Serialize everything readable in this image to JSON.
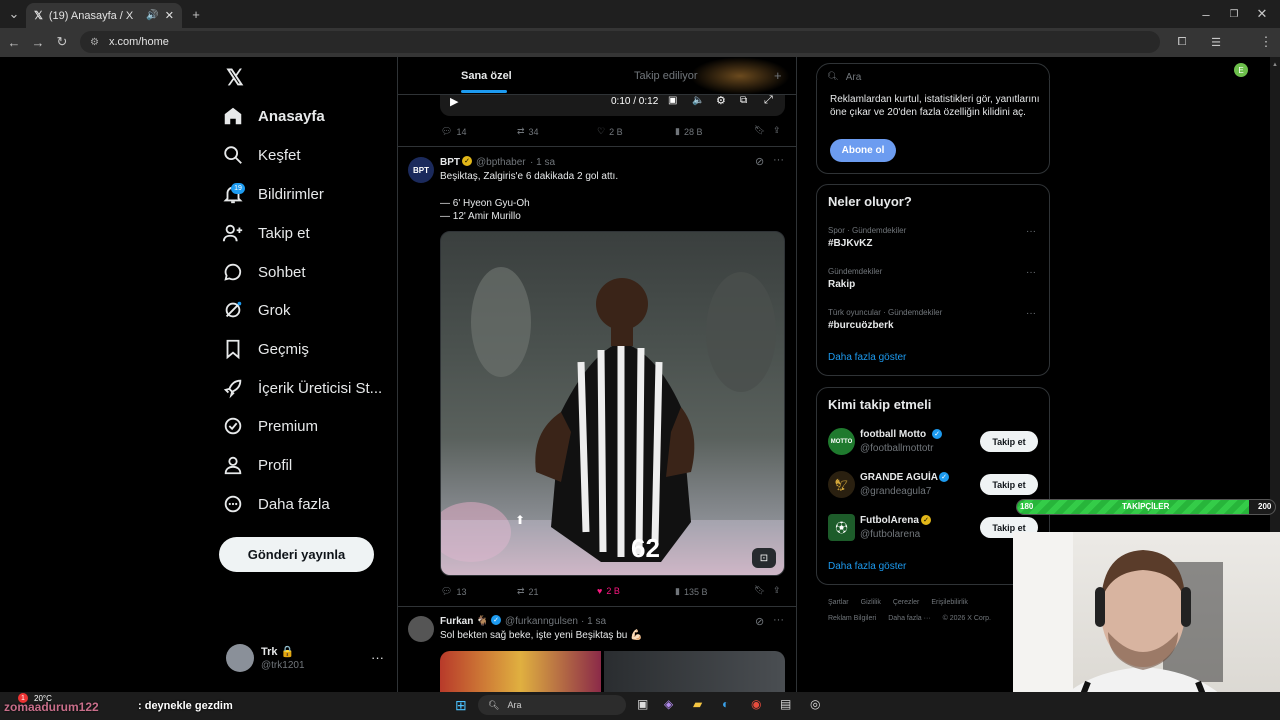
{
  "browser": {
    "tab_title": "(19) Anasayfa / X",
    "url": "x.com/home"
  },
  "nav": {
    "items": [
      "Anasayfa",
      "Keşfet",
      "Bildirimler",
      "Takip et",
      "Sohbet",
      "Grok",
      "Geçmiş",
      "İçerik Üreticisi St...",
      "Premium",
      "Profil",
      "Daha fazla"
    ],
    "notif_badge": "19",
    "post_button": "Gönderi yayınla",
    "account": {
      "name": "Trk 🔒",
      "handle": "@trk1201"
    }
  },
  "tabs": {
    "for_you": "Sana özel",
    "following": "Takip ediliyor"
  },
  "video": {
    "time": "0:10 / 0:12"
  },
  "prev_post_actions": {
    "replies": "14",
    "reposts": "34",
    "likes": "2 B",
    "views": "28 B"
  },
  "post1": {
    "author": "BPT",
    "handle": "@bpthaber",
    "time": "· 1 sa",
    "text1": "Beşiktaş, Zalgiris'e 6 dakikada 2 gol attı.",
    "line2": "— 6' Hyeon Gyu-Oh",
    "line3": "— 12' Amir Murillo",
    "replies": "13",
    "reposts": "21",
    "likes": "2 B",
    "views": "135 B"
  },
  "post2": {
    "author": "Furkan 🐐",
    "handle": "@furkanngulsen",
    "time": "· 1 sa",
    "text": "Sol bekten sağ beke, işte yeni Beşiktaş bu 💪🏻"
  },
  "search": {
    "placeholder": "Ara"
  },
  "premium": {
    "text": "Reklamlardan kurtul, istatistikleri gör, yanıtlarını öne çıkar ve 20'den fazla özelliğin kilidini aç.",
    "button": "Abone ol"
  },
  "trends": {
    "title": "Neler oluyor?",
    "items": [
      {
        "context": "Spor · Gündemdekiler",
        "name": "#BJKvKZ"
      },
      {
        "context": "Gündemdekiler",
        "name": "Rakip"
      },
      {
        "context": "Türk oyuncular · Gündemdekiler",
        "name": "#burcuözberk"
      }
    ],
    "more": "Daha fazla göster"
  },
  "who_to_follow": {
    "title": "Kimi takip etmeli",
    "items": [
      {
        "name": "football Motto",
        "handle": "@footballmottotr",
        "button": "Takip et"
      },
      {
        "name": "GRANDE AGUİA",
        "handle": "@grandeagula7",
        "button": "Takip et"
      },
      {
        "name": "FutbolArena",
        "handle": "@futbolarena",
        "button": "Takip et"
      }
    ],
    "more": "Daha fazla göster"
  },
  "footer": {
    "links1": [
      "Şartlar",
      "Gizlilik",
      "Çerezler",
      "Erişilebilirlik"
    ],
    "links2": [
      "Reklam Bilgileri",
      "Daha fazla ···",
      "© 2026 X Corp."
    ]
  },
  "overlay": {
    "left": "180",
    "label": "TAKİPÇİLER",
    "right": "200",
    "progress": 0.9
  },
  "chat": {
    "user": "zomaadurum122",
    "message": ": deynekle gezdim"
  },
  "taskbar": {
    "weather": "20°C",
    "search": "Ara"
  },
  "colors": {
    "accent": "#1d9bf0",
    "like": "#f91880",
    "overlay_green": "#2ecc40"
  }
}
